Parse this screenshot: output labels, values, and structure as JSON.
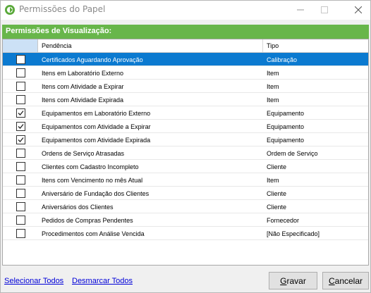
{
  "window": {
    "title": "Permissões do Papel"
  },
  "section": {
    "title": "Permissões de Visualização:"
  },
  "grid": {
    "columns": [
      "Pendência",
      "Tipo"
    ],
    "rows": [
      {
        "pendencia": "Certificados Aguardando Aprovação",
        "tipo": "Calibração",
        "checked": false,
        "selected": true
      },
      {
        "pendencia": "Itens em Laboratório Externo",
        "tipo": "Item",
        "checked": false,
        "selected": false
      },
      {
        "pendencia": "Itens com Atividade a Expirar",
        "tipo": "Item",
        "checked": false,
        "selected": false
      },
      {
        "pendencia": "Itens com Atividade Expirada",
        "tipo": "Item",
        "checked": false,
        "selected": false
      },
      {
        "pendencia": "Equipamentos em Laboratório Externo",
        "tipo": "Equipamento",
        "checked": true,
        "selected": false
      },
      {
        "pendencia": "Equipamentos com Atividade a Expirar",
        "tipo": "Equipamento",
        "checked": true,
        "selected": false
      },
      {
        "pendencia": "Equipamentos com Atividade Expirada",
        "tipo": "Equipamento",
        "checked": true,
        "selected": false
      },
      {
        "pendencia": "Ordens de Serviço Atrasadas",
        "tipo": "Ordem de Serviço",
        "checked": false,
        "selected": false
      },
      {
        "pendencia": "Clientes com Cadastro Incompleto",
        "tipo": "Cliente",
        "checked": false,
        "selected": false
      },
      {
        "pendencia": "Itens com Vencimento no mês Atual",
        "tipo": "Item",
        "checked": false,
        "selected": false
      },
      {
        "pendencia": "Aniversário de Fundação dos Clientes",
        "tipo": "Cliente",
        "checked": false,
        "selected": false
      },
      {
        "pendencia": "Aniversários dos Clientes",
        "tipo": "Cliente",
        "checked": false,
        "selected": false
      },
      {
        "pendencia": "Pedidos de Compras Pendentes",
        "tipo": "Fornecedor",
        "checked": false,
        "selected": false
      },
      {
        "pendencia": "Procedimentos com Análise Vencida",
        "tipo": "[Não Especificado]",
        "checked": false,
        "selected": false
      }
    ]
  },
  "footer": {
    "select_all": "Selecionar Todos",
    "unselect_all": "Desmarcar Todos",
    "save_prefix": "G",
    "save_rest": "ravar",
    "cancel_prefix": "C",
    "cancel_rest": "ancelar"
  },
  "colors": {
    "header_green": "#68b64a",
    "selection_blue": "#0b7ad0",
    "link_blue": "#0000d8"
  },
  "icons": [
    "app-logo-icon",
    "minimize-icon",
    "maximize-icon",
    "close-icon",
    "checkmark-icon"
  ]
}
